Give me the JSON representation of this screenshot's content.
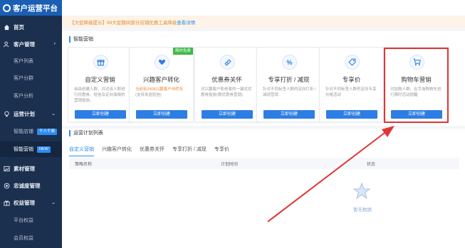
{
  "app": {
    "title": "客户运营平台"
  },
  "sidebar": {
    "home": "首页",
    "customer_mgmt": "客户管理",
    "customer_list": "客户列表",
    "customer_group": "客户分群",
    "customer_analysis": "客户分析",
    "ops_plan": "运营计划",
    "smart_push": "智能店铺",
    "smart_push_tag": "千人千面",
    "smart_marketing": "智能营销",
    "smart_marketing_tag": "NEW",
    "material_mgmt": "素材管理",
    "loyalty_mgmt": "忠诚度管理",
    "rights_mgmt": "权益管理",
    "platform_rights": "平台权益",
    "member_rights": "会员权益"
  },
  "notice": {
    "text": "【大促降级提示】99大促期间部分店铺优惠工具降级",
    "link": "查看详情"
  },
  "marketing": {
    "section_title": "智能营销",
    "cards": [
      {
        "title": "自定义营销",
        "desc": "自由创建人群，并对该人群进行优惠券、短信及定向海报的营销投放。",
        "button": "立即创建"
      },
      {
        "title": "兴趣客户转化",
        "warn": "当前有2408兴趣客户待转化",
        "desc": "(支持发送短信)",
        "button": "立即创建",
        "badge": "限时免费"
      },
      {
        "title": "优惠券关怀",
        "desc": "对兴趣客户和老客的一键式优惠券投放(限优惠券营销)",
        "button": "立即创建"
      },
      {
        "title": "专享打折 / 减现",
        "desc": "针对不同标签人群的定向打折 / 减现营销",
        "button": "立即创建"
      },
      {
        "title": "专享价",
        "desc": "针对不同标签人群的定向专享价格活动",
        "button": "立即创建"
      },
      {
        "title": "购物车营销",
        "desc": "对加购人群，在手淘购物车进行限时活动提醒",
        "button": "立即创建"
      }
    ]
  },
  "plans": {
    "section_title": "运营计划列表",
    "tabs": [
      "自定义营销",
      "兴趣客户转化",
      "优惠券关怀",
      "专享打折 / 减现",
      "专享价"
    ],
    "columns": [
      "策略名称",
      "计划时间",
      "状态"
    ],
    "empty_text": "暂无数据"
  }
}
